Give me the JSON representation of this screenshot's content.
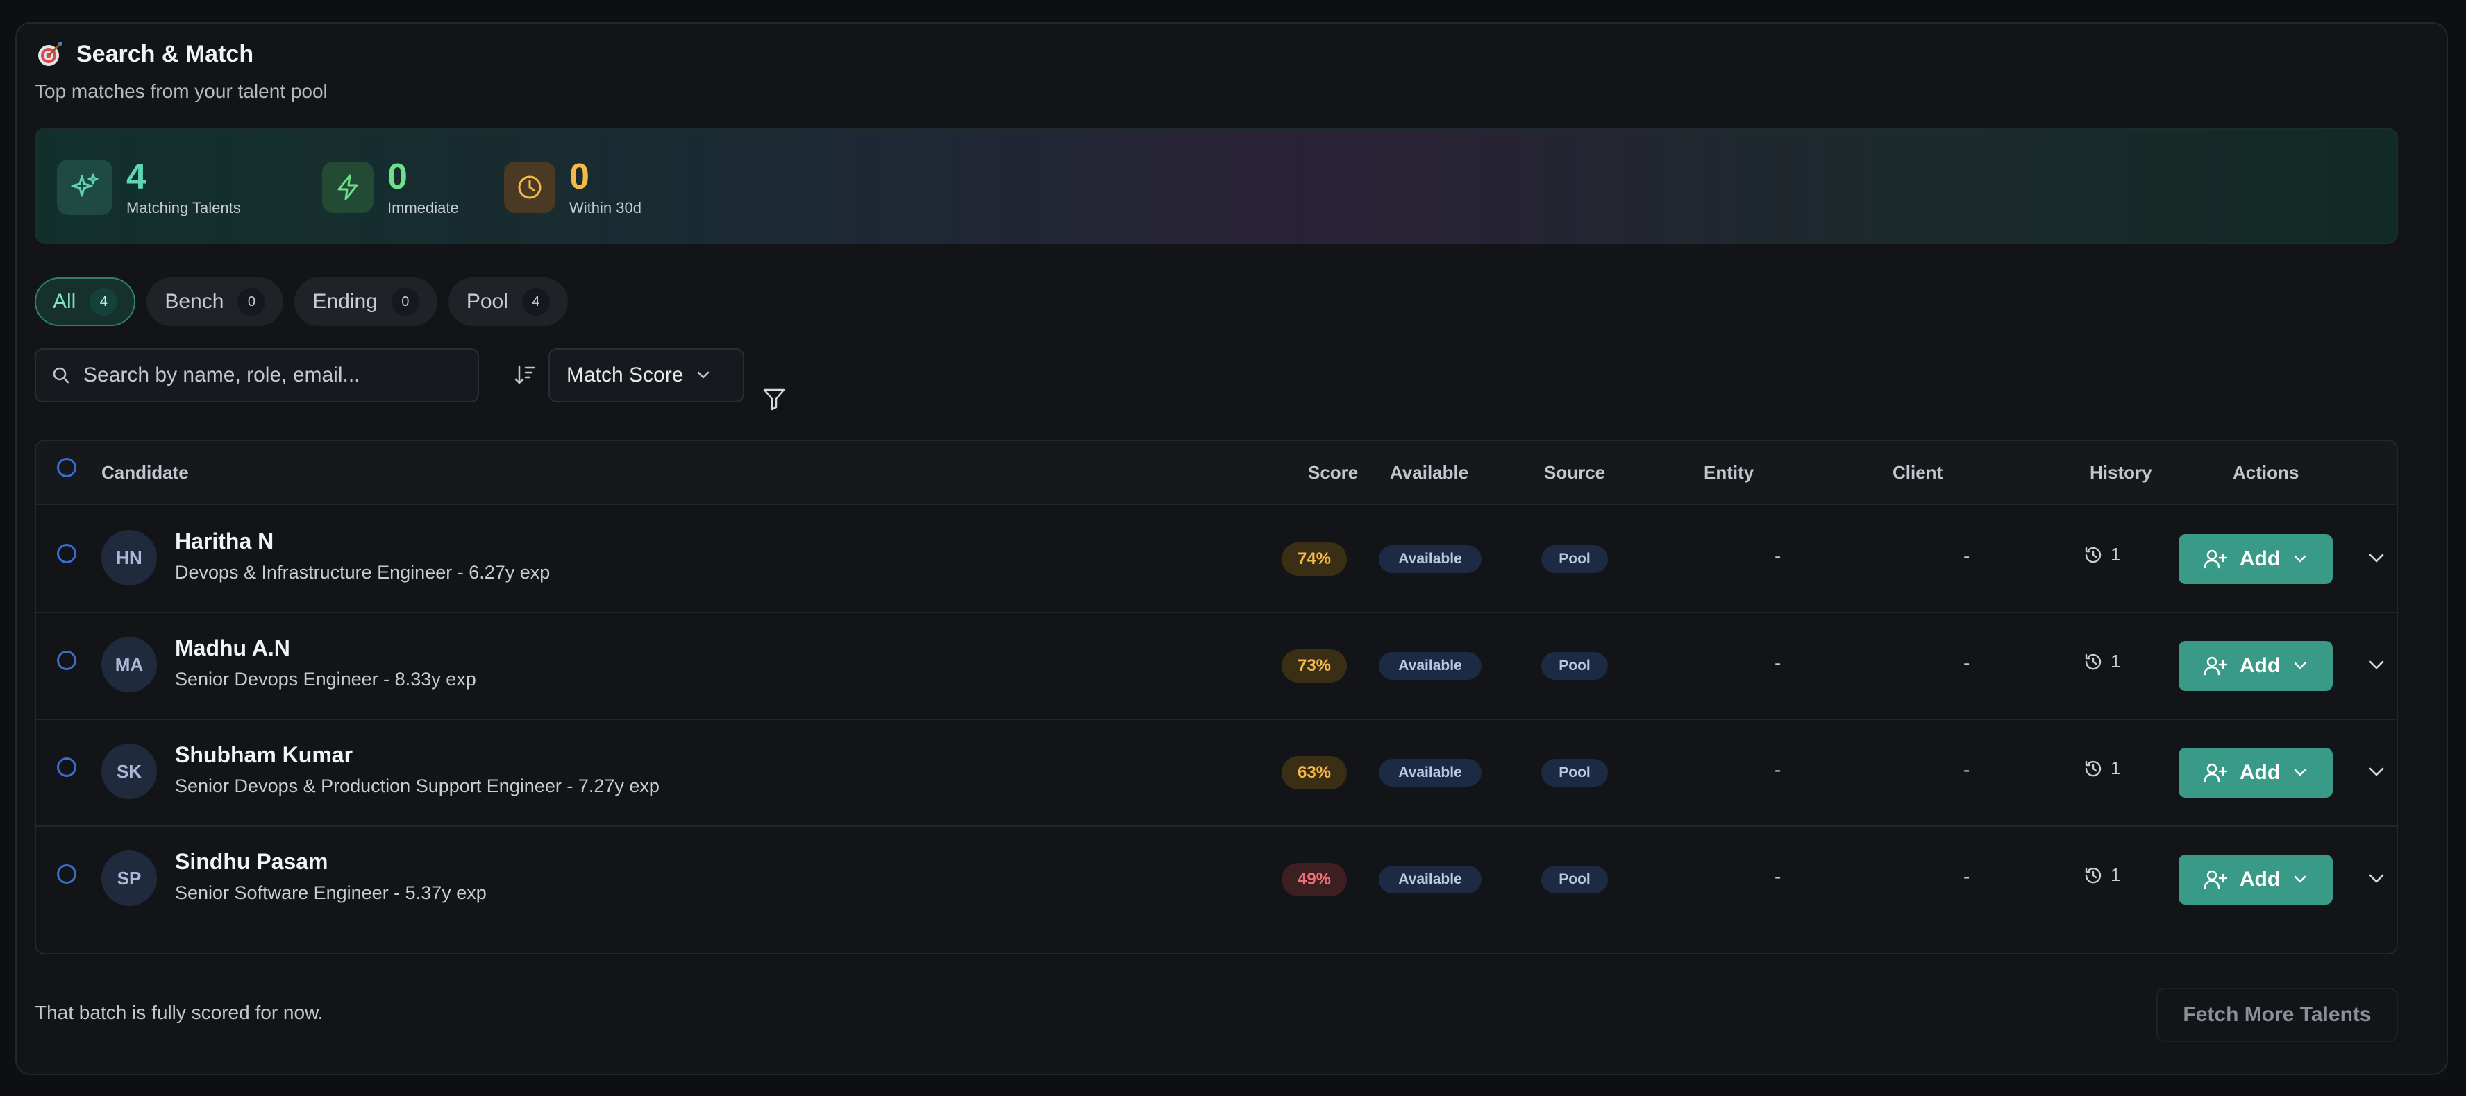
{
  "header": {
    "title": "Search & Match",
    "subtitle": "Top matches from your talent pool"
  },
  "stats": [
    {
      "icon": "sparkle-icon",
      "value": "4",
      "label": "Matching Talents",
      "color": "#5ed6b4"
    },
    {
      "icon": "lightning-icon",
      "value": "0",
      "label": "Immediate",
      "color": "#6ee08a"
    },
    {
      "icon": "clock-icon",
      "value": "0",
      "label": "Within 30d",
      "color": "#f5b94a"
    }
  ],
  "tabs": [
    {
      "label": "All",
      "count": "4",
      "active": true
    },
    {
      "label": "Bench",
      "count": "0"
    },
    {
      "label": "Ending",
      "count": "0"
    },
    {
      "label": "Pool",
      "count": "4"
    }
  ],
  "search": {
    "placeholder": "Search by name, role, email..."
  },
  "sort": {
    "label": "Match Score"
  },
  "table": {
    "columns": [
      "Candidate",
      "Score",
      "Available",
      "Source",
      "Entity",
      "Client",
      "History",
      "Actions"
    ],
    "rows": [
      {
        "initials": "HN",
        "name": "Haritha N",
        "role": "Devops & Infrastructure Engineer - 6.27y exp",
        "score": "74%",
        "score_level": "mid",
        "available": "Available",
        "source": "Pool",
        "entity": "-",
        "client": "-",
        "history": "1",
        "action": "Add"
      },
      {
        "initials": "MA",
        "name": "Madhu A.N",
        "role": "Senior Devops Engineer - 8.33y exp",
        "score": "73%",
        "score_level": "mid",
        "available": "Available",
        "source": "Pool",
        "entity": "-",
        "client": "-",
        "history": "1",
        "action": "Add"
      },
      {
        "initials": "SK",
        "name": "Shubham Kumar",
        "role": "Senior Devops & Production Support Engineer - 7.27y exp",
        "score": "63%",
        "score_level": "mid",
        "available": "Available",
        "source": "Pool",
        "entity": "-",
        "client": "-",
        "history": "1",
        "action": "Add"
      },
      {
        "initials": "SP",
        "name": "Sindhu Pasam",
        "role": "Senior Software Engineer - 5.37y exp",
        "score": "49%",
        "score_level": "low",
        "available": "Available",
        "source": "Pool",
        "entity": "-",
        "client": "-",
        "history": "1",
        "action": "Add"
      }
    ]
  },
  "footer": {
    "message": "That batch is fully scored for now.",
    "fetch_label": "Fetch More Talents"
  }
}
